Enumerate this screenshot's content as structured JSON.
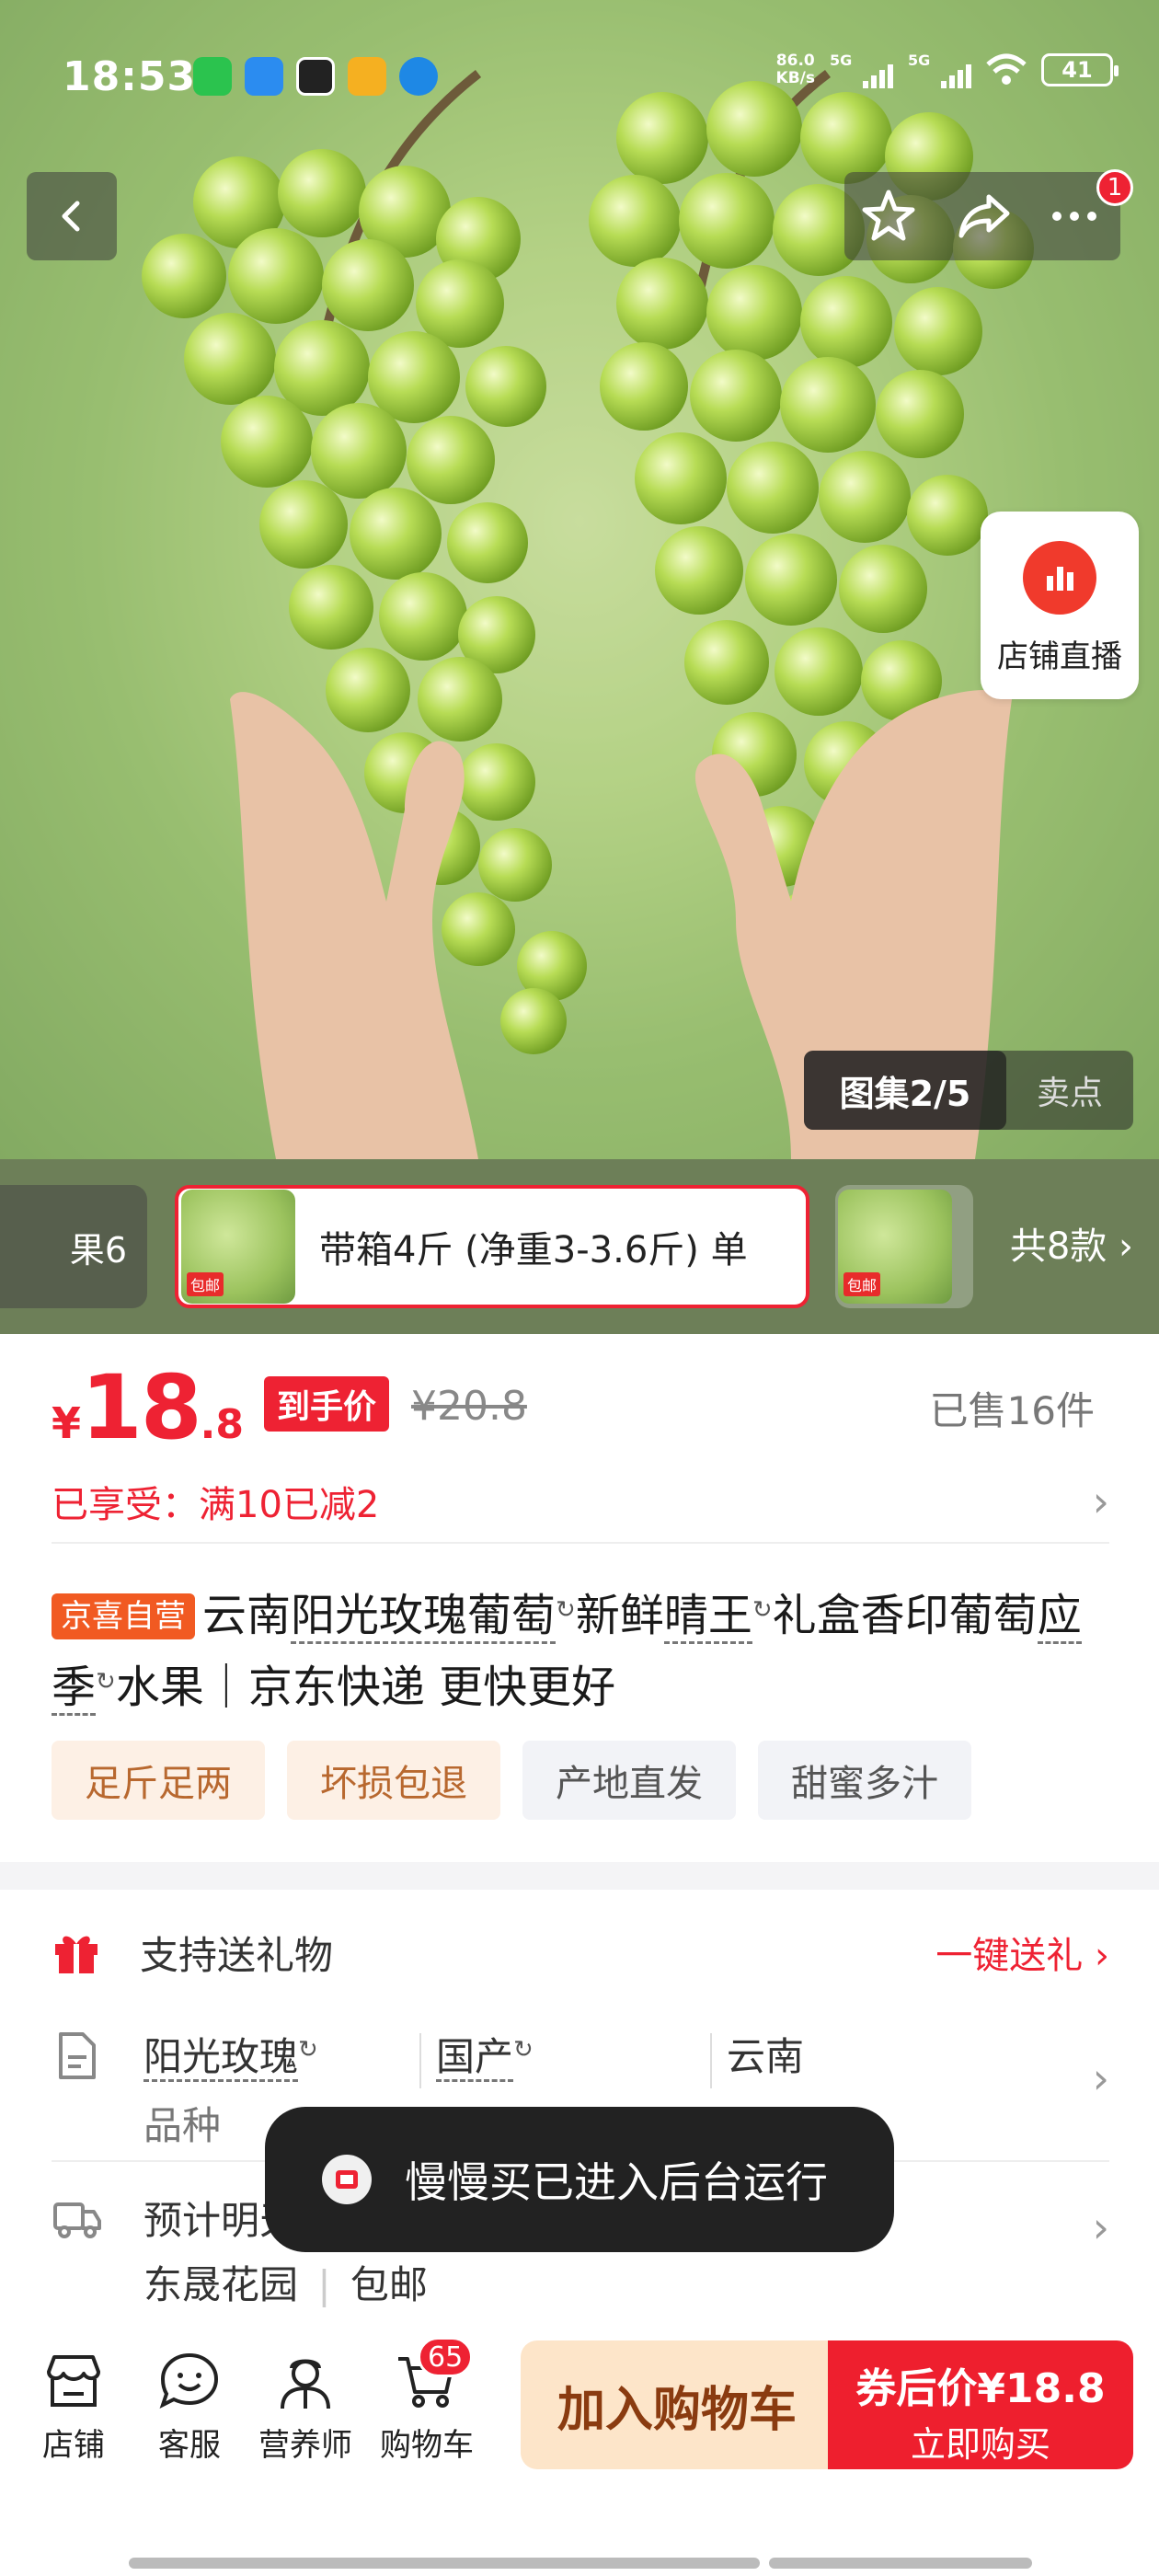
{
  "status_bar": {
    "time": "18:53",
    "net_speed_value": "86.0",
    "net_speed_unit": "KB/s",
    "sig1": "5G",
    "sig2": "5G",
    "battery": "41"
  },
  "header": {
    "notification_count": "1"
  },
  "live": {
    "label": "店铺直播"
  },
  "gallery": {
    "count": "图集2/5",
    "sell_point": "卖点"
  },
  "variants": {
    "first_label": "果6",
    "selected_label": "带箱4斤 (净重3-3.6斤) 单",
    "total": "共8款 ›",
    "thumb_tag": "包邮"
  },
  "price": {
    "symbol": "¥",
    "integer": "18",
    "decimal": ".8",
    "tag": "到手价",
    "original": "¥20.8",
    "sold": "已售16件"
  },
  "promo": {
    "text": "已享受：满10已减2"
  },
  "title": {
    "badge": "京喜自营",
    "p1": "云南",
    "k1": "阳光玫瑰葡萄",
    "p2": "新鲜",
    "k2": "晴王",
    "p3": "礼盒香印葡",
    "p4": "萄",
    "k3": "应季",
    "p5": "水果｜京东快递 更快更好"
  },
  "tags": [
    "足斤足两",
    "坏损包退",
    "产地直发",
    "甜蜜多汁"
  ],
  "gift": {
    "label": "支持送礼物",
    "link": "一键送礼 ›"
  },
  "specs": {
    "variety_value": "阳光玫瑰",
    "variety_key": "品种",
    "origin_value": "国产",
    "province": "云南"
  },
  "delivery": {
    "line1": "预计明天发货",
    "line2a": "东晟花园",
    "line2b": "包邮"
  },
  "toast": {
    "text": "慢慢买已进入后台运行"
  },
  "bottom_nav": {
    "store": "店铺",
    "service": "客服",
    "nutrition": "营养师",
    "cart": "购物车",
    "cart_count": "65"
  },
  "cta": {
    "add_cart": "加入购物车",
    "buy_line1": "券后价¥18.8",
    "buy_line2": "立即购买"
  },
  "colors": {
    "accent": "#ee2233",
    "cart_btn_bg": "#fde5c9",
    "badge_self": "#f15a22"
  }
}
